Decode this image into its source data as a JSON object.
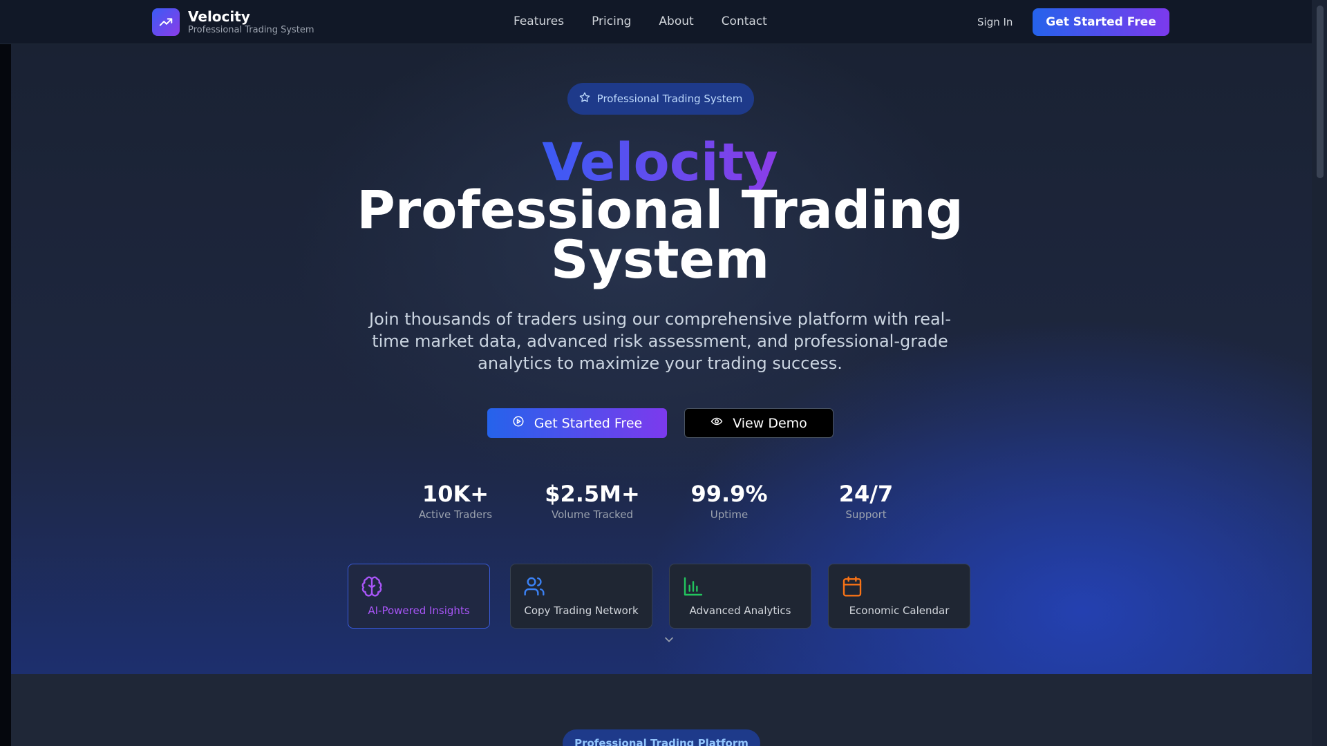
{
  "brand": {
    "name": "Velocity",
    "tagline": "Professional Trading System",
    "accent_from": "#3b5bf5",
    "accent_to": "#8b3de8"
  },
  "nav": {
    "links": [
      "Features",
      "Pricing",
      "About",
      "Contact"
    ],
    "sign_in": "Sign In",
    "cta": "Get Started Free"
  },
  "hero": {
    "badge": "Professional Trading System",
    "title_brand": "Velocity",
    "title_line1": "Professional Trading",
    "title_line2": "System",
    "lead": "Join thousands of traders using our comprehensive platform with real-time market data, advanced risk assessment, and professional-grade analytics to maximize your trading success.",
    "primary_button": "Get Started Free",
    "secondary_button": "View Demo"
  },
  "stats": [
    {
      "value": "10K+",
      "label": "Active Traders"
    },
    {
      "value": "$2.5M+",
      "label": "Volume Tracked"
    },
    {
      "value": "99.9%",
      "label": "Uptime"
    },
    {
      "value": "24/7",
      "label": "Support"
    }
  ],
  "features": [
    {
      "label": "AI-Powered Insights",
      "icon": "brain-icon",
      "color": "#a855f7"
    },
    {
      "label": "Copy Trading Network",
      "icon": "users-icon",
      "color": "#3b82f6"
    },
    {
      "label": "Advanced Analytics",
      "icon": "bar-chart-icon",
      "color": "#22c55e"
    },
    {
      "label": "Economic Calendar",
      "icon": "calendar-icon",
      "color": "#f97316"
    }
  ],
  "section2": {
    "badge": "Professional Trading Platform"
  }
}
